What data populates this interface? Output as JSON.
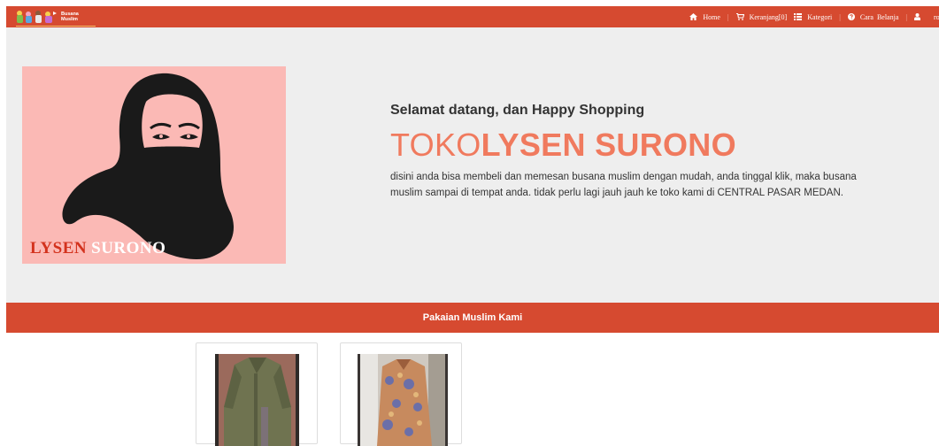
{
  "brand": {
    "line1": "Busana",
    "line2": "Muslim"
  },
  "nav": {
    "home": "Home",
    "cart": "Keranjang[0]",
    "category": "Kategori",
    "how_to": "Cara  Belanja",
    "user_partial": "ro",
    "separator": "|",
    "icons": {
      "home": "home-icon",
      "cart": "cart-icon",
      "category": "list-icon",
      "how_to": "question-circle-icon",
      "user": "user-icon"
    }
  },
  "hero": {
    "image_brand_part1": "LYSEN",
    "image_brand_part2": "SURONO",
    "greeting": "Selamat datang, dan Happy Shopping",
    "title_light": "TOKO",
    "title_bold": "LYSEN SURONO",
    "description": "disini anda bisa membeli dan memesan busana muslim dengan mudah, anda tinggal klik, maka busana muslim sampai di tempat anda. tidak perlu lagi jauh jauh ke toko kami di CENTRAL PASAR MEDAN."
  },
  "section": {
    "title": "Pakaian Muslim Kami"
  },
  "colors": {
    "primary": "#d64a30",
    "hero_bg": "#eeeeee",
    "title_accent": "#f07a5e",
    "image_bg": "#fbb9b5"
  }
}
